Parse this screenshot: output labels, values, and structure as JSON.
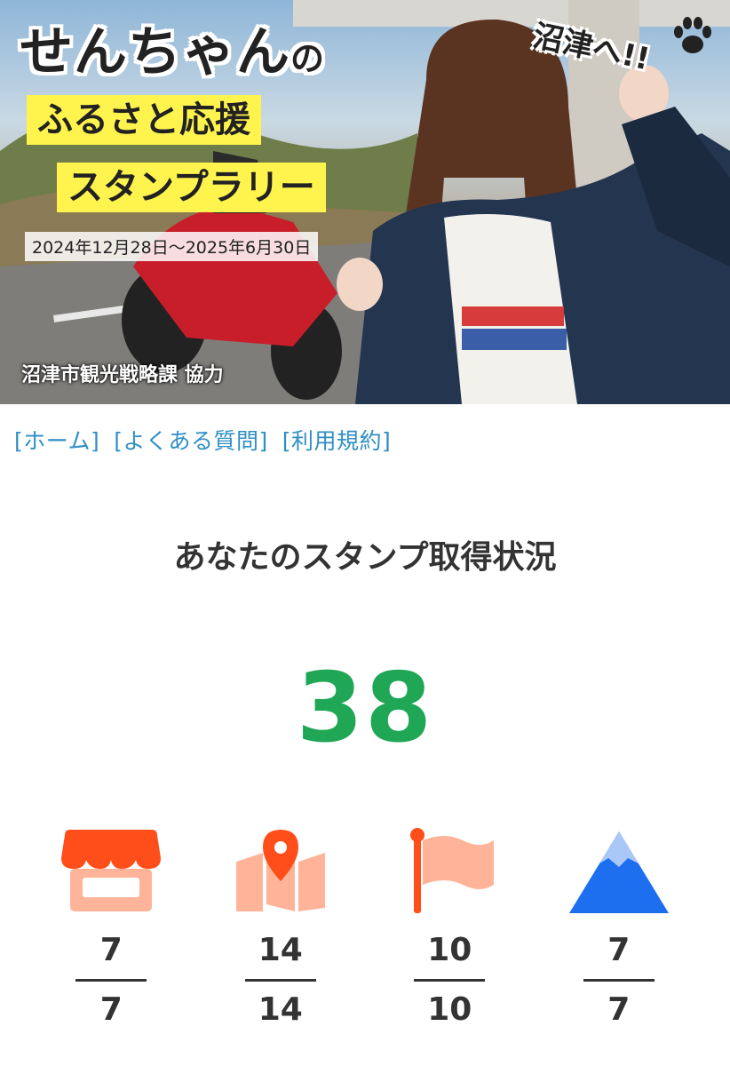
{
  "hero": {
    "title_main": "せんちゃん",
    "title_no": "の",
    "subtitle_line1": "ふるさと応援",
    "subtitle_line2": "スタンプラリー",
    "period": "2024年12月28日〜2025年6月30日",
    "credit": "沼津市観光戦略課 協力",
    "tagline": "沼津へ!!",
    "paw_icon": "paw-icon"
  },
  "nav": {
    "home": "[ホーム]",
    "faq": "[よくある質問]",
    "terms": "[利用規約]"
  },
  "status": {
    "heading": "あなたのスタンプ取得状況",
    "total": "38",
    "total_color": "#1fa756"
  },
  "stats": [
    {
      "icon": "shop-icon",
      "count": "7",
      "max": "7",
      "color": "#ff5722"
    },
    {
      "icon": "map-pin-icon",
      "count": "14",
      "max": "14",
      "color": "#ff5722"
    },
    {
      "icon": "flag-icon",
      "count": "10",
      "max": "10",
      "color": "#ff5722"
    },
    {
      "icon": "mountain-icon",
      "count": "7",
      "max": "7",
      "color": "#1e6ff0"
    }
  ]
}
